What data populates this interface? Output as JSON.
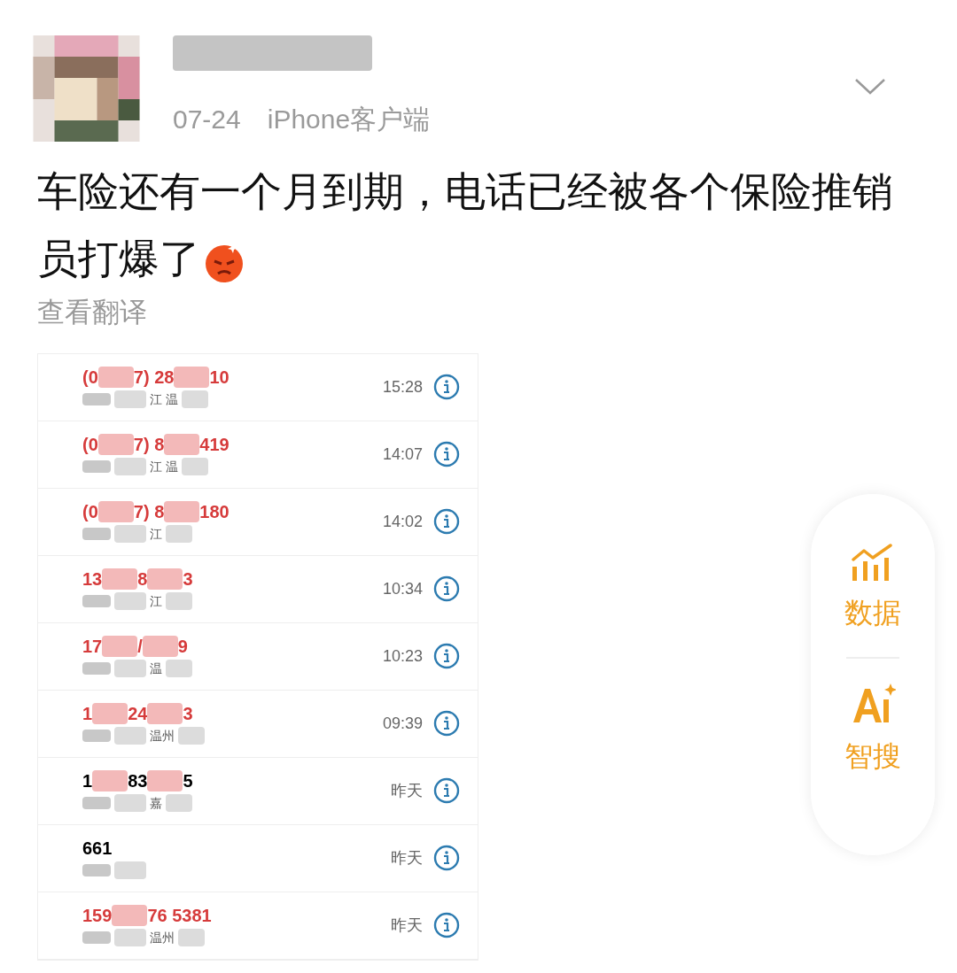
{
  "post": {
    "date": "07-24",
    "source": "iPhone客户端",
    "text": "车险还有一个月到期，电话已经被各个保险推销员打爆了",
    "translate": "查看翻译"
  },
  "calls": [
    {
      "missed": true,
      "number_parts": [
        "(0",
        "7) 28",
        "10"
      ],
      "location_parts": [
        "江 温"
      ],
      "time": "15:28"
    },
    {
      "missed": true,
      "number_parts": [
        "(0",
        "7) 8",
        "419"
      ],
      "location_parts": [
        "江 温"
      ],
      "time": "14:07"
    },
    {
      "missed": true,
      "number_parts": [
        "(0",
        "7) 8",
        "180"
      ],
      "location_parts": [
        "江"
      ],
      "time": "14:02"
    },
    {
      "missed": true,
      "number_parts": [
        "13",
        "8",
        "3"
      ],
      "location_parts": [
        "江"
      ],
      "time": "10:34"
    },
    {
      "missed": true,
      "number_parts": [
        "17",
        "/",
        "9"
      ],
      "location_parts": [
        "温"
      ],
      "time": "10:23"
    },
    {
      "missed": true,
      "number_parts": [
        "1",
        "24",
        "3"
      ],
      "location_parts": [
        "温州"
      ],
      "time": "09:39"
    },
    {
      "missed": false,
      "number_parts": [
        "1",
        "83",
        "5"
      ],
      "location_parts": [
        "嘉"
      ],
      "time": "昨天"
    },
    {
      "missed": false,
      "number_parts": [
        "661"
      ],
      "time": "昨天"
    },
    {
      "missed": true,
      "number_parts": [
        "159",
        "76 5381"
      ],
      "location_parts": [
        "温州"
      ],
      "time": "昨天"
    }
  ],
  "side_actions": [
    {
      "kind": "data",
      "label": "数据"
    },
    {
      "kind": "ai",
      "label": "智搜"
    }
  ]
}
